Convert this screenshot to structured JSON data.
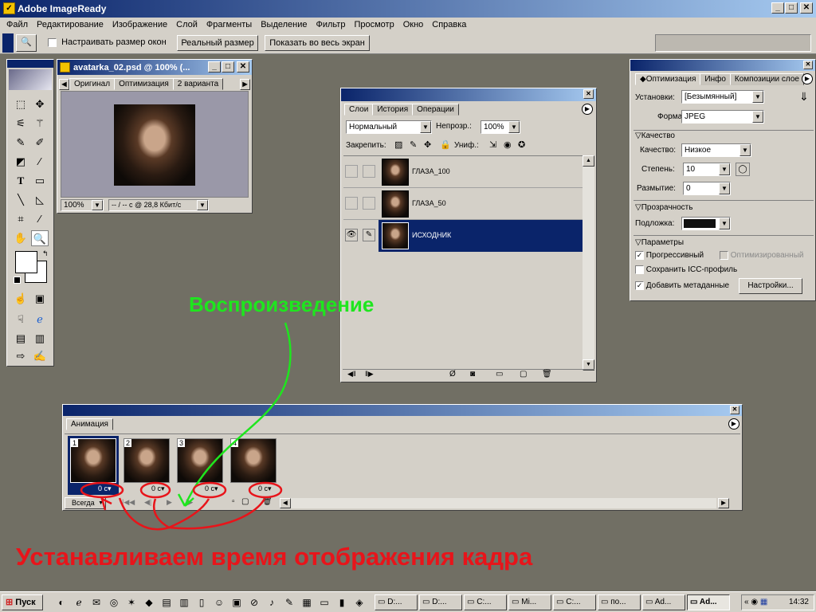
{
  "app": {
    "title": "Adobe ImageReady"
  },
  "menu": [
    "Файл",
    "Редактирование",
    "Изображение",
    "Слой",
    "Фрагменты",
    "Выделение",
    "Фильтр",
    "Просмотр",
    "Окно",
    "Справка"
  ],
  "options_bar": {
    "resize_label": "Настраивать размер окон",
    "btn_actual": "Реальный размер",
    "btn_fit": "Показать во весь экран"
  },
  "doc": {
    "title": "avatarka_02.psd @ 100% (...",
    "tabs": [
      "Оригинал",
      "Оптимизация",
      "2 варианта"
    ],
    "zoom": "100%",
    "status": "-- / -- с @ 28,8 Кбит/с"
  },
  "layers": {
    "tabs": [
      "Слои",
      "История",
      "Операции"
    ],
    "blend": "Нормальный",
    "opacity_label": "Непрозр.:",
    "opacity": "100%",
    "lock_label": "Закрепить:",
    "unify_label": "Униф.:",
    "items": [
      {
        "name": "ГЛАЗА_100"
      },
      {
        "name": "ГЛАЗА_50"
      },
      {
        "name": "ИСХОДНИК"
      }
    ]
  },
  "optimize": {
    "tabs": [
      "Оптимизация",
      "Инфо",
      "Композиции слое"
    ],
    "settings_label": "Установки:",
    "settings_value": "[Безымянный]",
    "format_label": "Формат:",
    "format_value": "JPEG",
    "quality_section": "Качество",
    "quality_label": "Качество:",
    "quality_value": "Низкое",
    "level_label": "Степень:",
    "level_value": "10",
    "blur_label": "Размытие:",
    "blur_value": "0",
    "transparency_section": "Прозрачность",
    "matte_label": "Подложка:",
    "params_section": "Параметры",
    "progressive": "Прогрессивный",
    "optimized": "Оптимизированный",
    "icc": "Сохранить ICC-профиль",
    "metadata": "Добавить метаданные",
    "settings_btn": "Настройки..."
  },
  "animation": {
    "tab": "Анимация",
    "frames": [
      {
        "num": "1",
        "delay": "0 с"
      },
      {
        "num": "2",
        "delay": "0 с"
      },
      {
        "num": "3",
        "delay": "0 с"
      },
      {
        "num": "4",
        "delay": "0 с"
      }
    ],
    "loop": "Всегда"
  },
  "annotations": {
    "play": "Воспроизведение",
    "caption": "Устанавливаем время отображения кадра"
  },
  "taskbar": {
    "start": "Пуск",
    "tasks": [
      "D:...",
      "D:...",
      "C:...",
      "Mi...",
      "C:...",
      "по...",
      "Ad...",
      "Ad..."
    ],
    "clock": "14:32"
  },
  "colors": {
    "annotation_green": "#1ee61e",
    "annotation_red": "#e8141a",
    "title_blue": "#0a246a",
    "selection": "#0a246a"
  }
}
